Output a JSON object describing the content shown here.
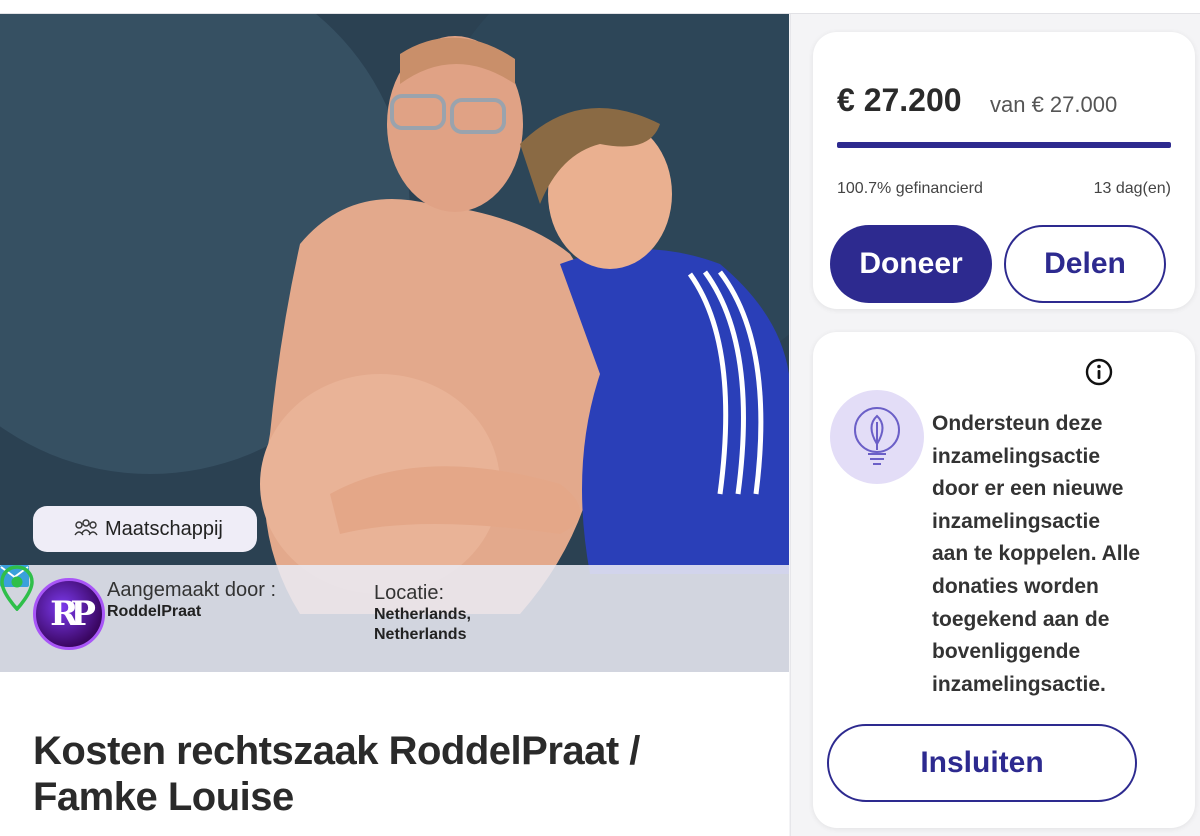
{
  "hero": {
    "category": {
      "label": "Maatschappij",
      "icon": "people-group-icon"
    },
    "creator": {
      "label": "Aangemaakt door :",
      "name": "RoddelPraat",
      "avatar_initials": "RP",
      "contact_icon": "mail-icon"
    },
    "location": {
      "label": "Locatie:",
      "line1": "Netherlands,",
      "line2": "Netherlands",
      "icon": "map-pin-icon"
    }
  },
  "campaign": {
    "title": "Kosten rechtszaak RoddelPraat / Famke Louise"
  },
  "funding": {
    "raised": "€ 27.200",
    "goal_text": "van € 27.000",
    "progress_fraction": 1.0,
    "funded_label": "100.7% gefinancierd",
    "days_left": "13 dag(en)",
    "donate_label": "Doneer",
    "share_label": "Delen"
  },
  "connect": {
    "info_icon": "info-icon",
    "badge_icon": "lightbulb-leaf-icon",
    "text": "Ondersteun deze inzamelingsactie door er een nieuwe inzamelingsactie aan te koppelen. Alle donaties worden toegekend aan de bovenliggende inzamelingsactie.",
    "lines": [
      "Ondersteun deze",
      "inzamelingsactie",
      "door er een nieuwe",
      "inzamelingsactie",
      "aan te koppelen. Alle",
      "donaties worden",
      "toegekend aan de",
      "bovenliggende",
      "inzamelingsactie."
    ],
    "embed_label": "Insluiten"
  },
  "colors": {
    "accent": "#2d2a8f",
    "pin_green": "#2fbf4a",
    "mail_blue": "#3aa0dc",
    "badge_purple": "#e3ddf7"
  }
}
